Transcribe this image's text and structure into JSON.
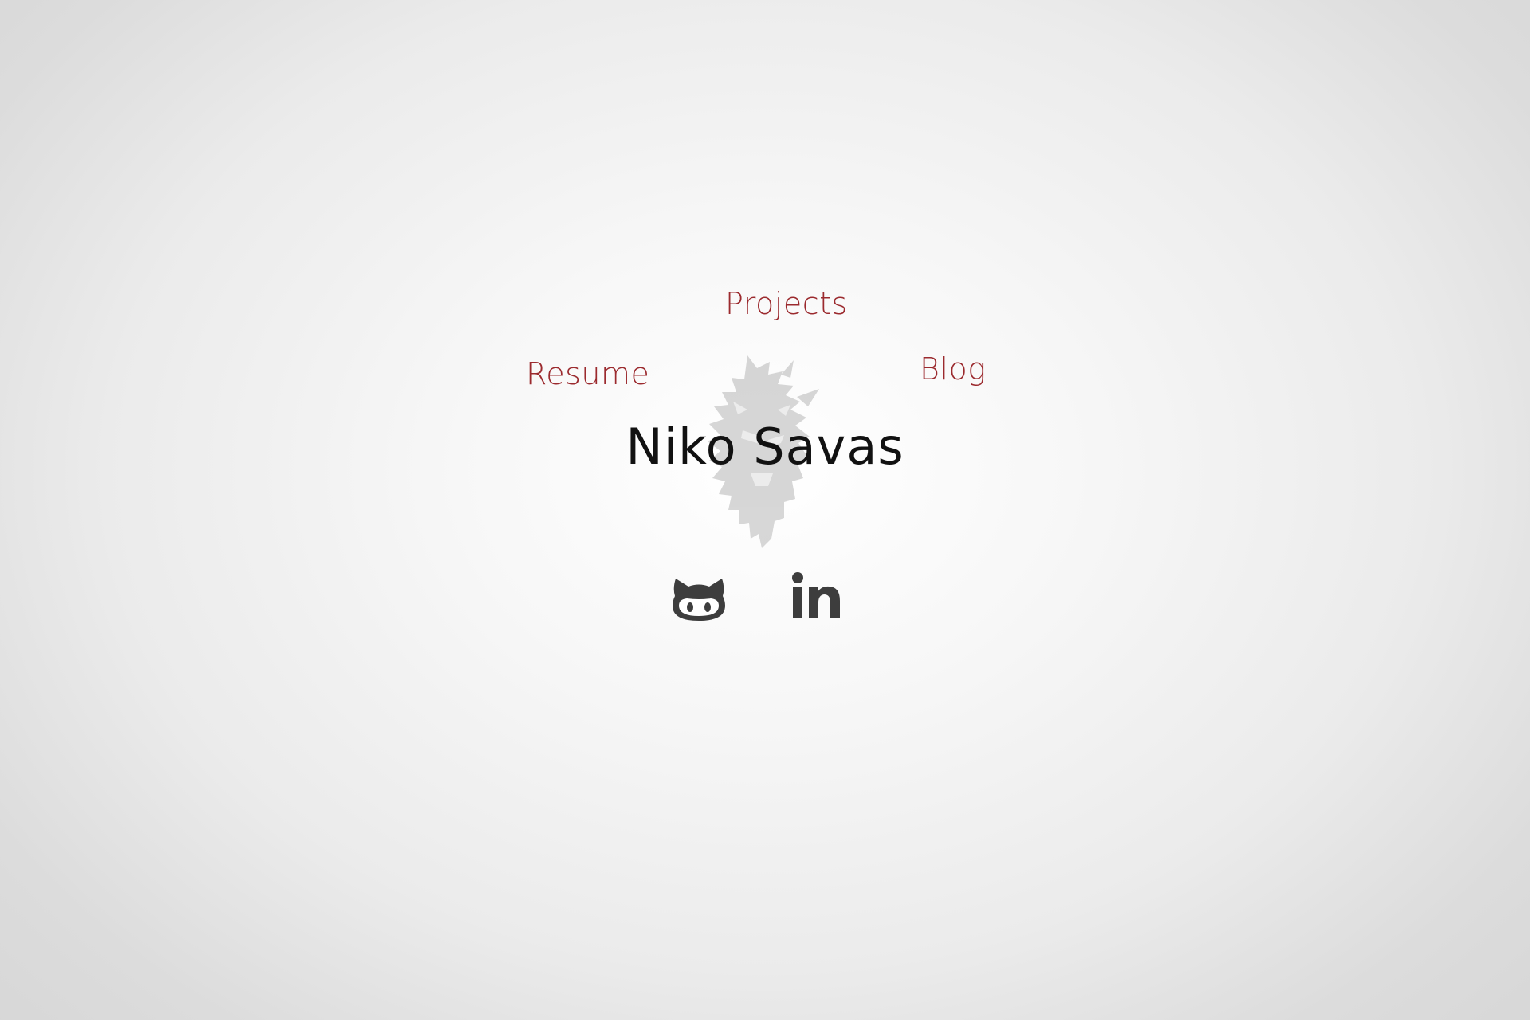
{
  "nav": {
    "projects": "Projects",
    "resume": "Resume",
    "blog": "Blog"
  },
  "hero": {
    "name": "Niko Savas",
    "logo_icon": "lion-head-icon"
  },
  "social": {
    "github_icon": "github-octocat-icon",
    "linkedin_icon": "linkedin-icon"
  },
  "colors": {
    "link": "#9b2a2e",
    "name": "#111111",
    "icon": "#3d3d3d",
    "logo": "#c9c9c9",
    "background_center": "#ffffff",
    "background_edge": "#d6d6d6"
  }
}
